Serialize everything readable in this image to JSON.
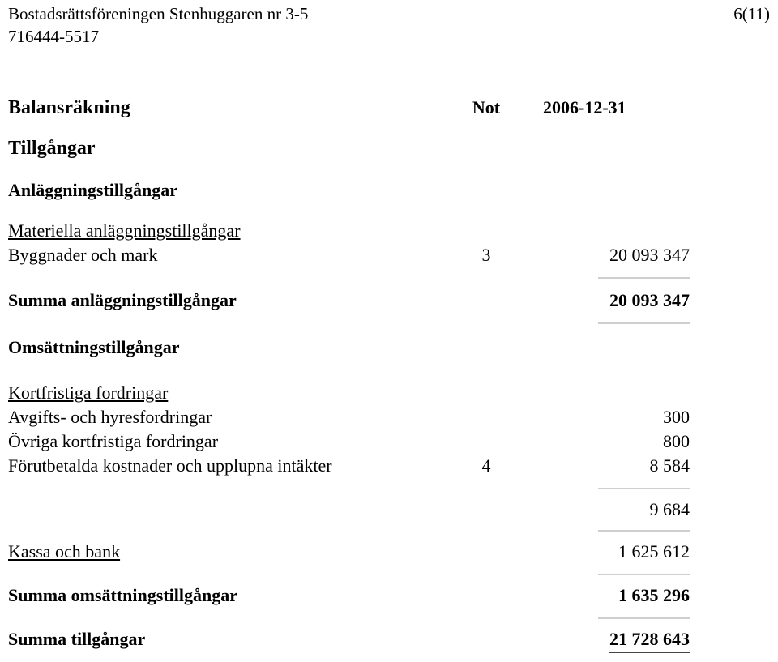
{
  "header": {
    "organization_name": "Bostadsrättsföreningen Stenhuggaren nr 3-5",
    "organization_number": "716444-5517",
    "page_number": "6(11)"
  },
  "statement": {
    "title": "Balansräkning",
    "note_column_header": "Not",
    "date_column_header": "2006-12-31",
    "section_assets": "Tillgångar",
    "heading_fixed_assets": "Anläggningstillgångar",
    "subhead_tangible": "Materiella anläggningstillgångar",
    "rows": {
      "buildings_land": {
        "label": "Byggnader och mark",
        "note": "3",
        "value": "20 093 347"
      },
      "sum_fixed_assets": {
        "label": "Summa anläggningstillgångar",
        "note": "",
        "value": "20 093 347"
      },
      "current_assets_heading": "Omsättningstillgångar",
      "subhead_short_receivables": "Kortfristiga fordringar",
      "fees_rent_receivables": {
        "label": "Avgifts- och hyresfordringar",
        "note": "",
        "value": "300"
      },
      "other_short_receivables": {
        "label": "Övriga kortfristiga fordringar",
        "note": "",
        "value": "800"
      },
      "prepaid_expenses": {
        "label": "Förutbetalda kostnader och upplupna intäkter",
        "note": "4",
        "value": "8 584"
      },
      "sum_receivables": {
        "label": "",
        "note": "",
        "value": "9 684"
      },
      "cash_bank": {
        "label": "Kassa och bank",
        "note": "",
        "value": "1 625 612"
      },
      "sum_current_assets": {
        "label": "Summa omsättningstillgångar",
        "note": "",
        "value": "1 635 296"
      },
      "total_assets": {
        "label": "Summa tillgångar",
        "note": "",
        "value": "21 728 643"
      }
    }
  },
  "colors": {
    "text": "#000000",
    "rule": "#cfcfcf",
    "total_rule": "#444444",
    "background": "#ffffff"
  }
}
